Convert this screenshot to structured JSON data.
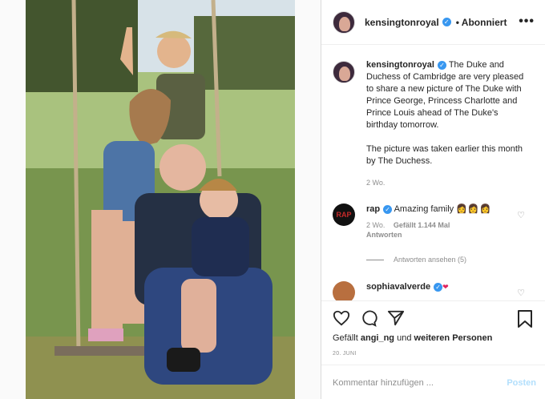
{
  "post": {
    "username": "kensingtonroyal",
    "follow_state": "Abonniert",
    "more_label": "•••"
  },
  "caption": {
    "username": "kensingtonroyal",
    "text_part1": "The Duke and Duchess of Cambridge are very pleased to share a new picture of The Duke with Prince George, Princess Charlotte and Prince Louis ahead of The Duke's birthday tomorrow.",
    "text_part2": "The picture was taken earlier this month by The Duchess.",
    "age": "2 Wo."
  },
  "comments": [
    {
      "username": "rap",
      "avatar_text": "RAP",
      "text": "Amazing family",
      "emojis": "👩👩👩",
      "age": "2 Wo.",
      "likes": "Gefällt 1.144 Mal",
      "reply": "Antworten"
    },
    {
      "username": "sophiavalverde",
      "emoji_badge": "❤"
    }
  ],
  "replies": {
    "label": "Antworten ansehen (5)"
  },
  "actions": {
    "like_icon": "heart-outline-icon",
    "comment_icon": "speech-bubble-icon",
    "share_icon": "paper-plane-icon",
    "save_icon": "bookmark-icon"
  },
  "likes": {
    "prefix": "Gefällt",
    "user": "angi_ng",
    "middle": "und",
    "suffix": "weiteren Personen"
  },
  "date": "20. JUNI",
  "composer": {
    "placeholder": "Kommentar hinzufügen ...",
    "post_label": "Posten"
  },
  "colors": {
    "verified": "#3897f0",
    "post_disabled": "#b2dffc",
    "border": "#dbdbdb"
  }
}
